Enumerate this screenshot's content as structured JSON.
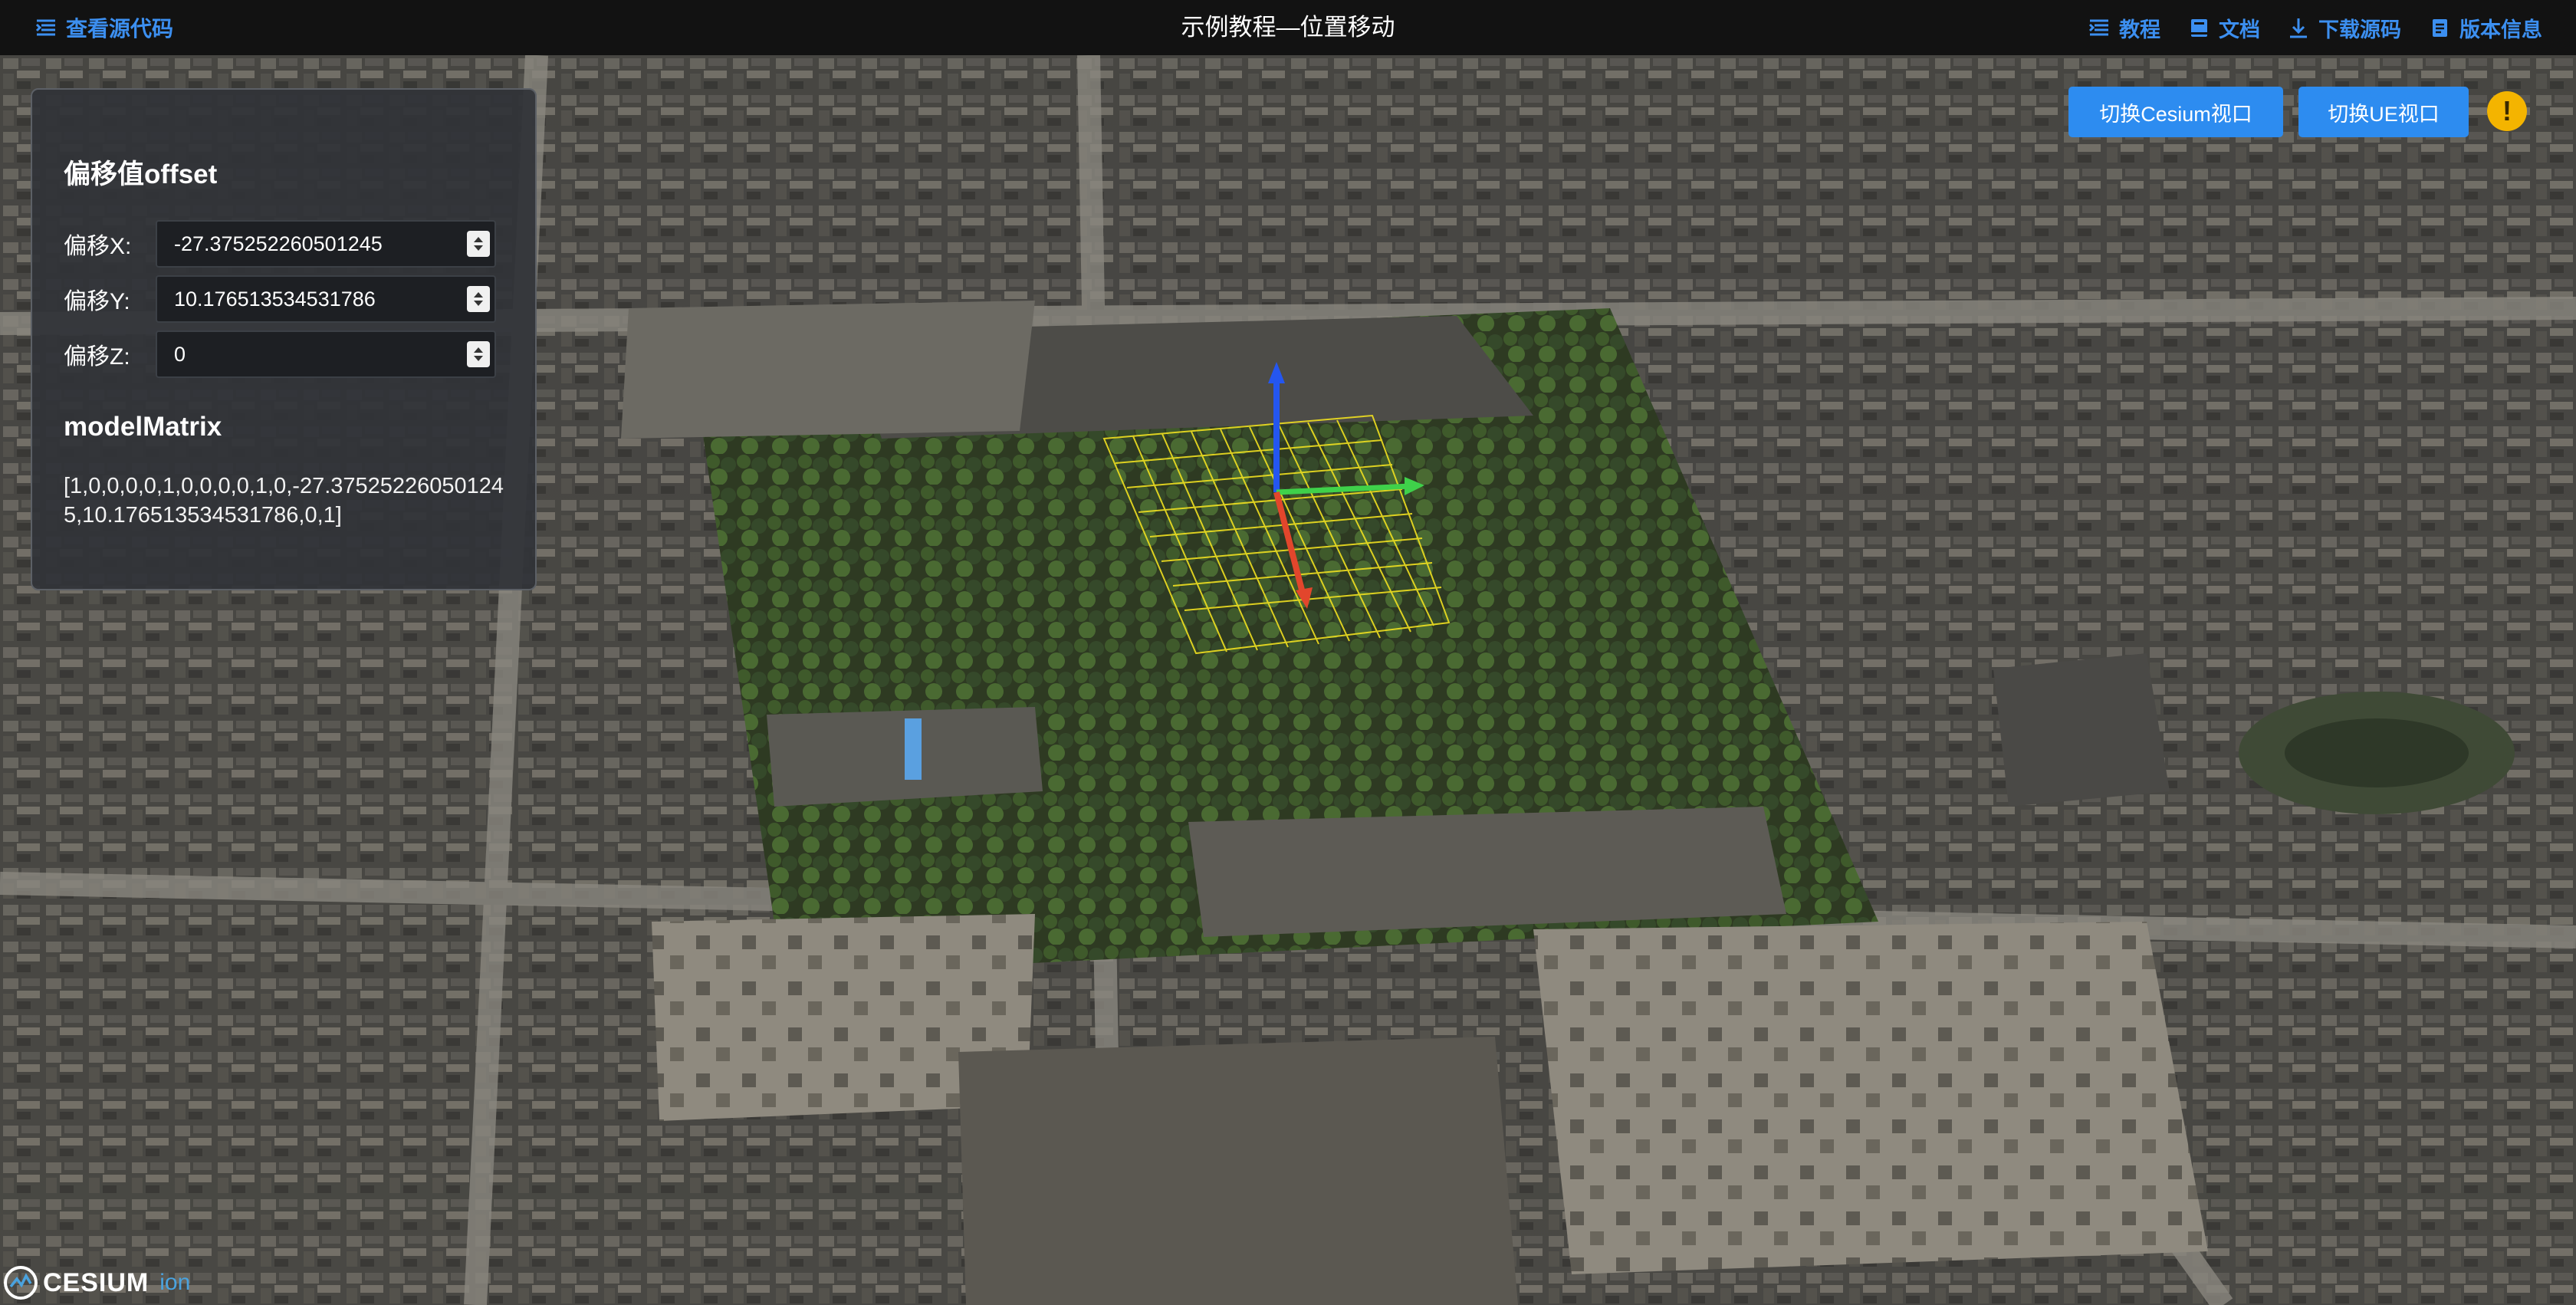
{
  "topbar": {
    "source_link": "查看源代码",
    "title": "示例教程—位置移动",
    "nav": [
      "教程",
      "文档",
      "下载源码",
      "版本信息"
    ]
  },
  "panel": {
    "offset_heading": "偏移值offset",
    "x_label": "偏移X:",
    "x_value": "-27.375252260501245",
    "y_label": "偏移Y:",
    "y_value": "10.176513534531786",
    "z_label": "偏移Z:",
    "z_value": "0",
    "matrix_heading": "modelMatrix",
    "matrix_value": "[1,0,0,0,0,1,0,0,0,0,1,0,-27.375252260501245,10.176513534531786,0,1]"
  },
  "buttons": {
    "cesium_view": "切换Cesium视口",
    "ue_view": "切换UE视口",
    "info": "!"
  },
  "logo": {
    "name": "CESIUM",
    "suffix": "ion"
  },
  "colors": {
    "accent": "#2d8cf0",
    "link": "#3c8ff0",
    "axis_x": "#e2462c",
    "axis_y": "#3fd14a",
    "axis_z": "#2456f0",
    "grid": "#f0e020",
    "warning": "#f4b400"
  }
}
